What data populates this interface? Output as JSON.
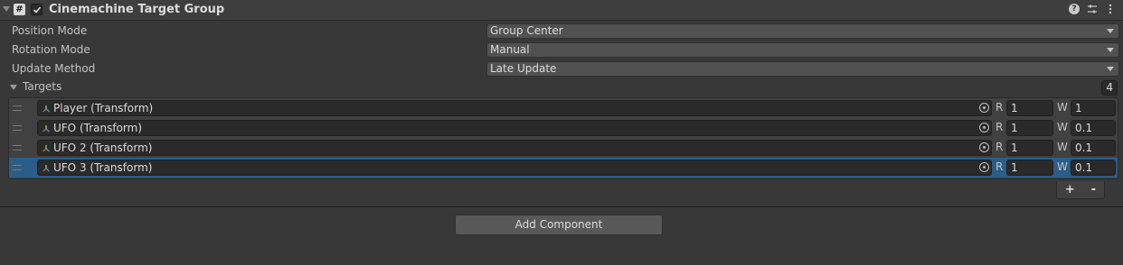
{
  "component": {
    "title": "Cinemachine Target Group",
    "icon": "hash-icon",
    "enabled": true
  },
  "fields": [
    {
      "label": "Position Mode",
      "value": "Group Center"
    },
    {
      "label": "Rotation Mode",
      "value": "Manual"
    },
    {
      "label": "Update Method",
      "value": "Late Update"
    }
  ],
  "targets": {
    "label": "Targets",
    "count": "4",
    "items": [
      {
        "object": "Player (Transform)",
        "radius_label": "R",
        "radius": "1",
        "weight_label": "W",
        "weight": "1",
        "selected": false
      },
      {
        "object": "UFO (Transform)",
        "radius_label": "R",
        "radius": "1",
        "weight_label": "W",
        "weight": "0.1",
        "selected": false
      },
      {
        "object": "UFO 2 (Transform)",
        "radius_label": "R",
        "radius": "1",
        "weight_label": "W",
        "weight": "0.1",
        "selected": false
      },
      {
        "object": "UFO 3 (Transform)",
        "radius_label": "R",
        "radius": "1",
        "weight_label": "W",
        "weight": "0.1",
        "selected": true
      }
    ],
    "add_label": "+",
    "remove_label": "-"
  },
  "add_component_label": "Add Component",
  "colors": {
    "background": "#383838",
    "selection": "#2c5d87"
  }
}
